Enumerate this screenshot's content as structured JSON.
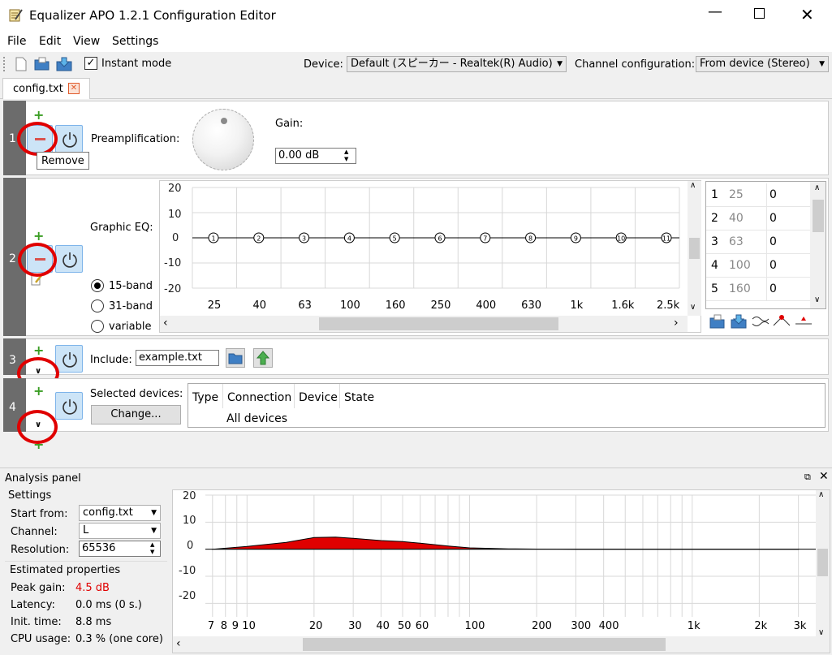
{
  "window": {
    "title": "Equalizer APO 1.2.1 Configuration Editor"
  },
  "menu": {
    "items": [
      "File",
      "Edit",
      "View",
      "Settings"
    ]
  },
  "toolbar": {
    "instant_mode_label": "Instant mode",
    "instant_mode_checked": true,
    "device_label": "Device:",
    "device_value": "Default (スピーカー - Realtek(R) Audio)",
    "channel_label": "Channel configuration:",
    "channel_value": "From device (Stereo)"
  },
  "tabs": [
    {
      "label": "config.txt"
    }
  ],
  "rows": {
    "row1": {
      "index": "1",
      "label": "Preamplification:",
      "gain_label": "Gain:",
      "gain_value": "0.00 dB",
      "tooltip": "Remove"
    },
    "row2": {
      "index": "2",
      "label": "Graphic EQ:",
      "modes": [
        "15-band",
        "31-band",
        "variable"
      ],
      "selected_mode": "15-band",
      "y_ticks": [
        "20",
        "10",
        "0",
        "-10",
        "-20"
      ],
      "x_ticks": [
        "25",
        "40",
        "63",
        "100",
        "160",
        "250",
        "400",
        "630",
        "1k",
        "1.6k",
        "2.5k"
      ],
      "table_rows": [
        {
          "n": "1",
          "freq": "25",
          "gain": "0"
        },
        {
          "n": "2",
          "freq": "40",
          "gain": "0"
        },
        {
          "n": "3",
          "freq": "63",
          "gain": "0"
        },
        {
          "n": "4",
          "freq": "100",
          "gain": "0"
        },
        {
          "n": "5",
          "freq": "160",
          "gain": "0"
        }
      ]
    },
    "row3": {
      "index": "3",
      "label": "Include:",
      "value": "example.txt"
    },
    "row4": {
      "index": "4",
      "label": "Selected devices:",
      "change_button": "Change...",
      "columns": [
        "Type",
        "Connection",
        "Device",
        "State"
      ],
      "rows": [
        {
          "type": "",
          "connection": "All devices",
          "device": "",
          "state": ""
        }
      ]
    }
  },
  "analysis": {
    "title": "Analysis panel",
    "settings_title": "Settings",
    "start_from_label": "Start from:",
    "start_from_value": "config.txt",
    "channel_label": "Channel:",
    "channel_value": "L",
    "resolution_label": "Resolution:",
    "resolution_value": "65536",
    "estimated_title": "Estimated properties",
    "peak_gain_label": "Peak gain:",
    "peak_gain_value": "4.5 dB",
    "peak_gain_color": "#e00000",
    "latency_label": "Latency:",
    "latency_value": "0.0 ms (0 s.)",
    "init_time_label": "Init. time:",
    "init_time_value": "8.8 ms",
    "cpu_label": "CPU usage:",
    "cpu_value": "0.3 % (one core)",
    "y_ticks": [
      "20",
      "10",
      "0",
      "-10",
      "-20"
    ],
    "x_ticks": [
      "7",
      "8",
      "9",
      "10",
      "20",
      "30",
      "40",
      "50",
      "60",
      "100",
      "200",
      "300",
      "400",
      "1k",
      "2k",
      "3k"
    ]
  },
  "chart_data": {
    "type": "area",
    "title": "",
    "xlabel": "",
    "ylabel": "",
    "ylim": [
      -25,
      20
    ],
    "x_scale": "log",
    "x": [
      7,
      10,
      15,
      20,
      25,
      30,
      40,
      50,
      60,
      80,
      100,
      150,
      200,
      300,
      400,
      1000,
      3000
    ],
    "series": [
      {
        "values": [
          0,
          1,
          2.5,
          4.3,
          4.5,
          4.0,
          3.2,
          2.8,
          2.2,
          1.2,
          0.5,
          0.15,
          0.05,
          0,
          0,
          0,
          0
        ]
      }
    ],
    "grid": true,
    "colors": {
      "fill": "#e00000"
    }
  }
}
